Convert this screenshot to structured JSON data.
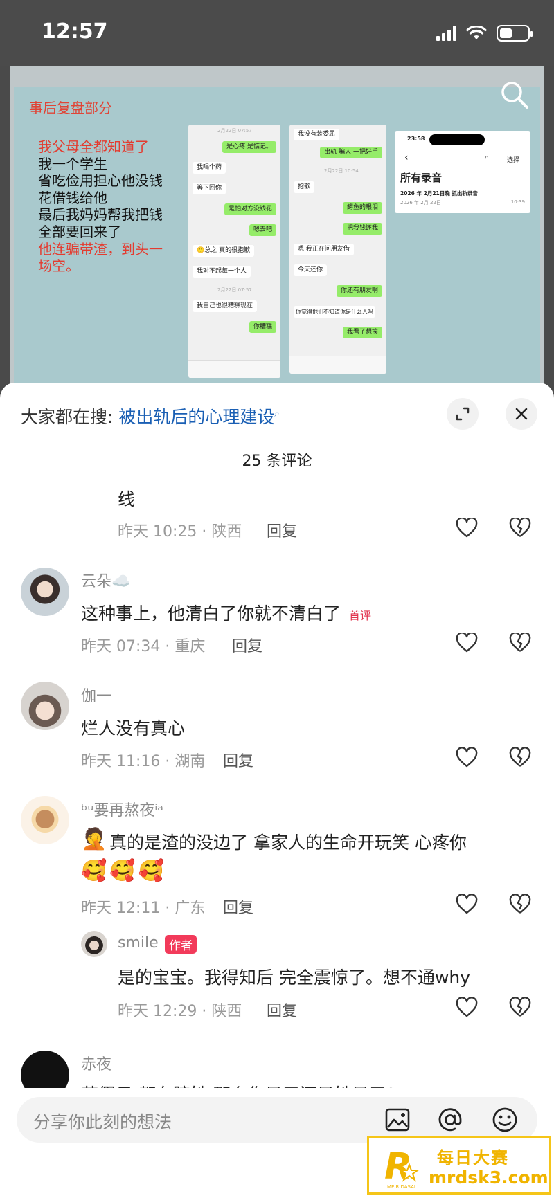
{
  "status": {
    "time": "12:57"
  },
  "post_image": {
    "heading": "事后复盘部分",
    "story_lines": [
      {
        "text": "我父母全都知道了",
        "red": true
      },
      {
        "text": "我一个学生",
        "red": false
      },
      {
        "text": "省吃俭用担心他没钱",
        "red": false
      },
      {
        "text": "花借钱给他",
        "red": false
      },
      {
        "text": "最后我妈妈帮我把钱",
        "red": false
      },
      {
        "text": "全部要回来了",
        "red": false
      },
      {
        "text": "他连骗带渣，到头一",
        "red": true
      },
      {
        "text": "场空。",
        "red": true
      }
    ],
    "chat1": [
      {
        "text": "是心疼 是惦记。",
        "me": true
      },
      {
        "text": "我喝个药",
        "me": false
      },
      {
        "text": "等下回你",
        "me": false
      },
      {
        "text": "是怕对方没钱花",
        "me": true
      },
      {
        "text": "嗯去吧",
        "me": true
      },
      {
        "text": "🙂总之 真的很抱歉",
        "me": false
      },
      {
        "text": "我对不起每一个人",
        "me": false
      },
      {
        "text": "我自己也很糟糕现在",
        "me": false
      },
      {
        "text": "你糟糕",
        "me": true
      }
    ],
    "chat1_times": [
      "2月22日 07:57",
      "2月22日 07:57",
      "2月22日 07:57"
    ],
    "chat2": [
      {
        "text": "我没有装委屈",
        "me": false
      },
      {
        "text": "出轨 骗人 一把好手",
        "me": true
      },
      {
        "text": "抱歉",
        "me": false
      },
      {
        "text": "鳄鱼的眼泪",
        "me": true
      },
      {
        "text": "把我钱还我",
        "me": true
      },
      {
        "text": "嗯 我正在问朋友借",
        "me": false
      },
      {
        "text": "今天还你",
        "me": false
      },
      {
        "text": "你还有朋友啊",
        "me": true
      },
      {
        "text": "你觉得他们不知道你是什么人吗",
        "me": false
      },
      {
        "text": "我看了想挨",
        "me": true
      }
    ],
    "chat2_times": [
      "2月22日 10:54"
    ],
    "recording": {
      "time": "23:58",
      "select_label": "选择",
      "title": "所有录音",
      "item_title": "2026 年 2月21日晚 抓出轨录音",
      "item_date": "2026 年 2月 22日",
      "item_duration": "10:39"
    }
  },
  "sheet": {
    "hot_search_prefix": "大家都在搜:",
    "hot_search_term": "被出轨后的心理建设",
    "comment_count": "25 条评论",
    "reply_label": "回复",
    "comments": [
      {
        "id": "c0",
        "name": "",
        "text": "线",
        "time": "昨天 10:25 · 陕西"
      },
      {
        "id": "c1",
        "name": "云朵☁️",
        "text": "这种事上，他清白了你就不清白了",
        "tag": "首评",
        "time": "昨天 07:34 · 重庆"
      },
      {
        "id": "c2",
        "name": "伽一",
        "text": "烂人没有真心",
        "time": "昨天 11:16 · 湖南"
      },
      {
        "id": "c3",
        "name": "ᵇᵘ要再熬夜ⁱᵃ",
        "text": "真的是渣的没边了 拿家人的生命开玩笑 心疼你",
        "emoji_prefix": "🤦",
        "emoji_line": "🥰🥰🥰",
        "time": "昨天 12:11 · 广东"
      },
      {
        "id": "c4",
        "name": "smile",
        "author_tag": "作者",
        "text": "是的宝宝。我得知后 完全震惊了。想不通why",
        "time": "昨天 12:29 · 陕西"
      },
      {
        "id": "c5",
        "name": "赤夜",
        "text": "节假日 都在陪她 那么你是三还是她是三?"
      }
    ]
  },
  "input": {
    "placeholder": "分享你此刻的想法"
  },
  "watermark": {
    "title": "每日大赛",
    "url": "mrdsk3.com",
    "sub": "MEIRIDASAI"
  },
  "colors": {
    "accent_red": "#e2334d",
    "link_blue": "#1a5fb4",
    "chat_green": "#95ec69",
    "watermark_gold": "#f0b400"
  }
}
